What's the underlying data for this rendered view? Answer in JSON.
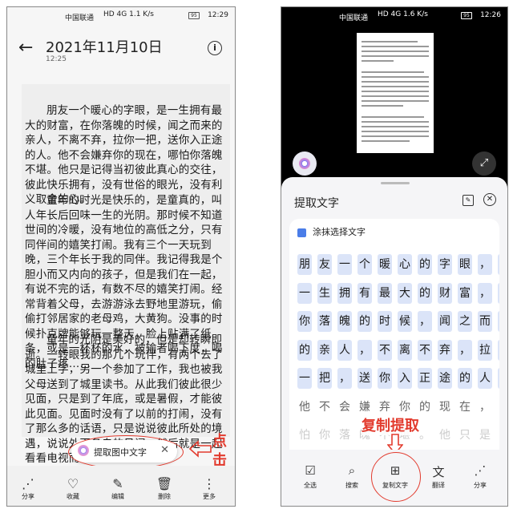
{
  "left": {
    "status": {
      "carrier": "中国联通",
      "signal": "HD 4G 1.1 K/s",
      "battery": "95",
      "time": "12:29"
    },
    "header": {
      "title": "2021年11月10日",
      "subtitle": "12:25"
    },
    "paragraphs": [
      "朋友一个暖心的字眼，是一生拥有最大的财富，在你落魄的时候，闻之而来的亲人，不离不弃，拉你一把，送你入正途的人。他不会嫌弃你的现在，哪怕你落魄不堪。他只是记得当初彼此真心的交往，彼此快乐拥有，没有世俗的眼光，没有利义取舍的心。",
      "童年的时光是快乐的，是童真的，叫人年长后回味一生的光阴。那时候不知道世间的冷暖，没有地位的高低之分，只有同伴间的嬉笑打闹。我有三个一天玩到晚，三个年长于我的同伴。我记得我是个胆小而又内向的孩子，但是我们在一起，有说不完的话，有数不尽的嬉笑打闹。经常背着父母，去游游泳去野地里游玩，偷偷打邻居家的老母鸡，大黄狗。没事的时候扑克牌能够玩一整天，脸上贴满了纸条，或是一杯杯的水，被输者喝下度，喝的肚子疼……",
      "童年的光阴是美好的，但是却转瞬即逝。一转眼我的那几个玩伴，有两个去了城里上学，另一个参加了工作，我也被我父母送到了城里读书。从此我们彼此很少见面，只是到了年底，或是暑假，才能彼此见面。见面时没有了以前的打闹，没有了那么多的话语，只是说说彼此所处的境遇，说说外面各自的见闻，然后就是一起看看电视而已……"
    ],
    "pill": {
      "label": "提取图中文字",
      "close": "✕"
    },
    "annotation": "点击",
    "toolbar": [
      {
        "icon": "share-icon",
        "glyph": "⋰",
        "label": "分享"
      },
      {
        "icon": "heart-icon",
        "glyph": "♡",
        "label": "收藏"
      },
      {
        "icon": "edit-icon",
        "glyph": "✎",
        "label": "编辑"
      },
      {
        "icon": "trash-icon",
        "glyph": "🗑",
        "label": "删除"
      },
      {
        "icon": "more-icon",
        "glyph": "⋮",
        "label": "更多"
      }
    ]
  },
  "right": {
    "status": {
      "carrier": "中国联通",
      "signal": "HD 4G 1.6 K/s",
      "battery": "95",
      "time": "12:26"
    },
    "sheet": {
      "title": "提取文字",
      "pick_label": "涂抹选择文字"
    },
    "rows": [
      [
        "朋",
        "友",
        "一",
        "个",
        "暖",
        "心",
        "的",
        "字",
        "眼",
        "，",
        "是"
      ],
      [
        "一",
        "生",
        "拥",
        "有",
        "最",
        "大",
        "的",
        "财",
        "富",
        "，",
        "在"
      ],
      [
        "你",
        "落",
        "魄",
        "的",
        "时",
        "候",
        "，",
        "闻",
        "之",
        "而",
        "来"
      ],
      [
        "的",
        "亲",
        "人",
        "，",
        "不",
        "离",
        "不",
        "弃",
        "，",
        "拉",
        "你"
      ],
      [
        "一",
        "把",
        "，",
        "送",
        "你",
        "入",
        "正",
        "途",
        "的",
        "人",
        "。"
      ],
      [
        "他",
        "不",
        "会",
        "嫌",
        "弃",
        "你",
        "的",
        "现",
        "在",
        "，",
        "哪"
      ],
      [
        "怕",
        "你",
        "落",
        "魄",
        "不",
        "堪",
        "。",
        "他",
        "只",
        "是",
        "记"
      ]
    ],
    "annotation": "复制提取",
    "toolbar": [
      {
        "icon": "select-all-icon",
        "glyph": "☑",
        "label": "全选"
      },
      {
        "icon": "search-icon",
        "glyph": "⌕",
        "label": "搜索"
      },
      {
        "icon": "copy-icon",
        "glyph": "⊞",
        "label": "复制文字"
      },
      {
        "icon": "translate-icon",
        "glyph": "文",
        "label": "翻译"
      },
      {
        "icon": "share-icon",
        "glyph": "⋰",
        "label": "分享"
      }
    ]
  }
}
